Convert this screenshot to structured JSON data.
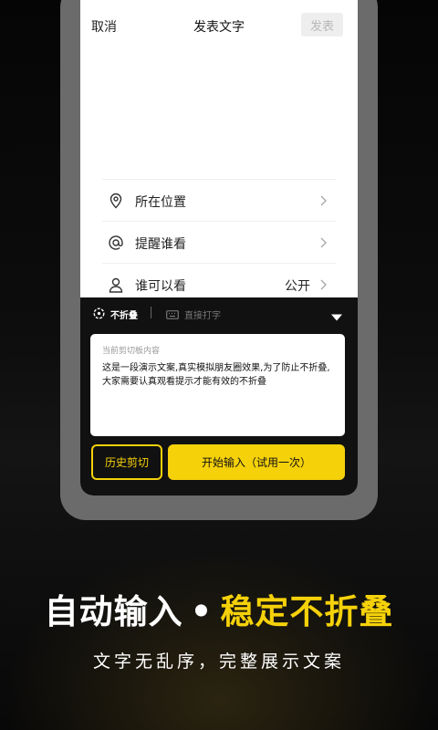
{
  "screen": {
    "topbar": {
      "cancel": "取消",
      "title": "发表文字",
      "publish": "发表"
    },
    "options": [
      {
        "icon": "location-pin-icon",
        "label": "所在位置",
        "value": ""
      },
      {
        "icon": "at-icon",
        "label": "提醒谁看",
        "value": ""
      },
      {
        "icon": "person-icon",
        "label": "谁可以看",
        "value": "公开"
      }
    ]
  },
  "panel": {
    "tab_nofold": "不折叠",
    "tab_direct": "直接打字",
    "clipboard_header": "当前剪切板内容",
    "clipboard_text": "这是一段演示文案,真实模拟朋友圈效果,为了防止不折叠,大家需要认真观看提示才能有效的不折叠",
    "history_button": "历史剪切",
    "start_button": "开始输入（试用一次）"
  },
  "promo": {
    "headline_left": "自动输入",
    "headline_dot": "•",
    "headline_right": "稳定不折叠",
    "subline": "文字无乱序，完整展示文案"
  },
  "colors": {
    "accent": "#f5d10a",
    "panel_bg": "#111111",
    "frame": "#6b6b6b"
  }
}
